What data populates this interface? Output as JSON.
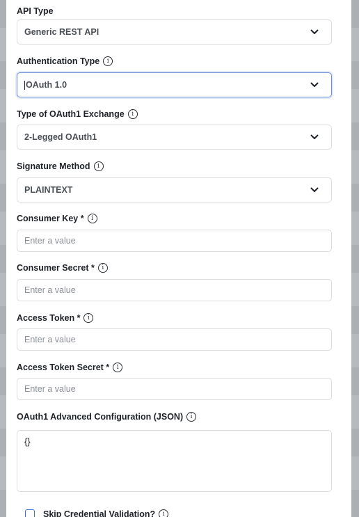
{
  "form": {
    "api_type": {
      "label": "API Type",
      "value": "Generic REST API"
    },
    "auth_type": {
      "label": "Authentication Type",
      "value": "OAuth 1.0"
    },
    "exchange_type": {
      "label": "Type of OAuth1 Exchange",
      "value": "2-Legged OAuth1"
    },
    "signature_method": {
      "label": "Signature Method",
      "value": "PLAINTEXT"
    },
    "consumer_key": {
      "label": "Consumer Key *",
      "placeholder": "Enter a value"
    },
    "consumer_secret": {
      "label": "Consumer Secret *",
      "placeholder": "Enter a value"
    },
    "access_token": {
      "label": "Access Token *",
      "placeholder": "Enter a value"
    },
    "access_token_secret": {
      "label": "Access Token Secret *",
      "placeholder": "Enter a value"
    },
    "advanced_config": {
      "label": "OAuth1 Advanced Configuration (JSON)",
      "value": "{}"
    },
    "skip_validation": {
      "label": "Skip Credential Validation?",
      "checked": false
    }
  },
  "icons": {
    "info": "info-icon",
    "dropdown": "chevron-down-icon"
  },
  "colors": {
    "focus_border": "#6b8fd6",
    "checkbox": "#3a6fe0"
  }
}
